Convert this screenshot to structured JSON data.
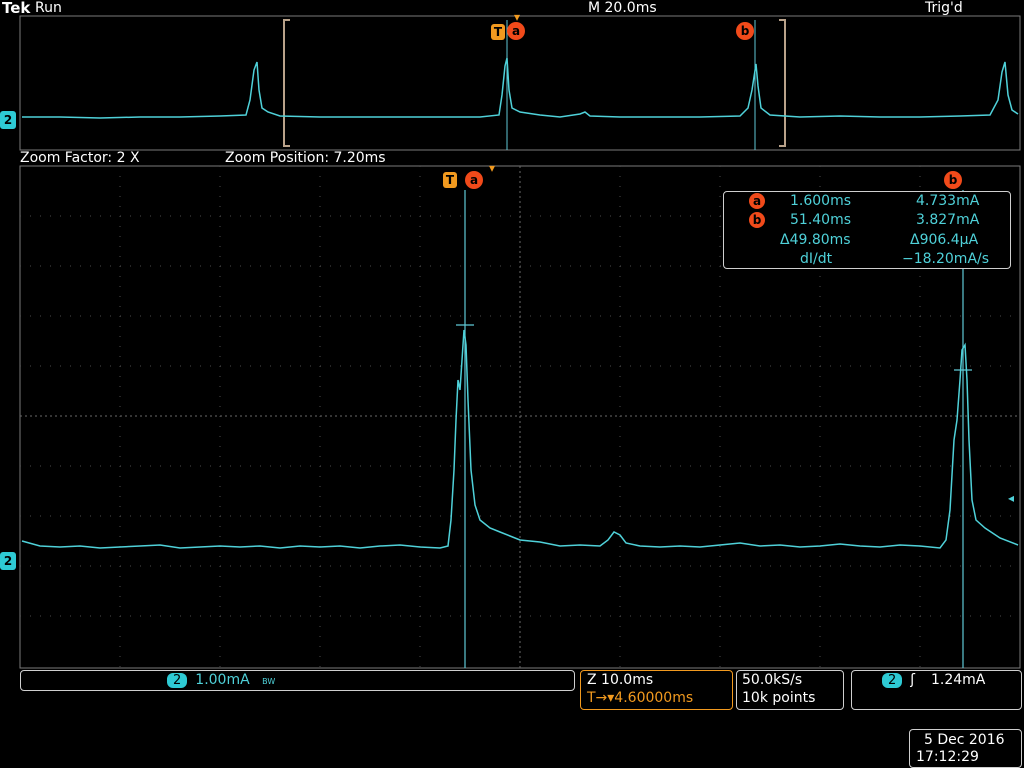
{
  "header": {
    "brand": "Tek",
    "run_state": "Run",
    "timebase": "M 20.0ms",
    "trigger_state": "Trig'd"
  },
  "zoom": {
    "factor": "Zoom Factor: 2 X",
    "position": "Zoom Position: 7.20ms"
  },
  "cursors": {
    "a_label": "a",
    "b_label": "b",
    "t_label": "T",
    "a_time": "1.600ms",
    "a_value": "4.733mA",
    "b_time": "51.40ms",
    "b_value": "3.827mA",
    "delta_time": "Δ49.80ms",
    "delta_value": "Δ906.4µA",
    "didt_label": "dI/dt",
    "didt_value": "−18.20mA/s"
  },
  "channel": {
    "number": "2",
    "scale": "1.00mA",
    "bw_symbol": "BW"
  },
  "horizontal": {
    "zoom_scale": "Z 10.0ms",
    "trigger_delay": "T→▾4.60000ms"
  },
  "acquisition": {
    "sample_rate": "50.0kS/s",
    "record_length": "10k points"
  },
  "trigger": {
    "channel": "2",
    "slope_icon": "rising-edge-icon",
    "level": "1.24mA"
  },
  "datetime": {
    "date": "5 Dec 2016",
    "time": "17:12:29"
  },
  "colors": {
    "trace": "#4fd1d9",
    "cursor": "#5fc9d6",
    "grid": "#555555",
    "accent_orange": "#f29a1f",
    "marker_red": "#f14a1a"
  }
}
